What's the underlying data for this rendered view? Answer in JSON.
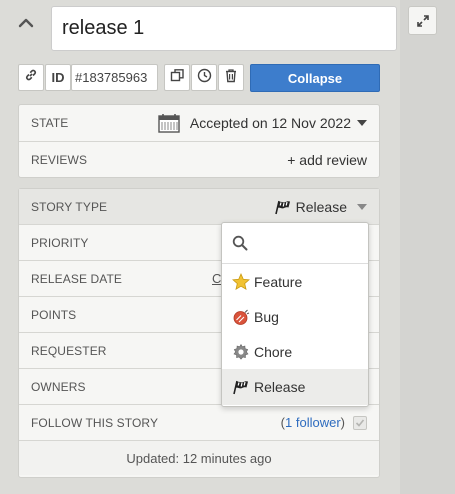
{
  "story": {
    "title": "release 1",
    "id_label": "ID",
    "id_value": "#183785963",
    "collapse_label": "Collapse"
  },
  "state": {
    "label": "STATE",
    "value": "Accepted on 12 Nov 2022"
  },
  "reviews": {
    "label": "REVIEWS",
    "add_label": "+ add review"
  },
  "fields": {
    "story_type": {
      "label": "STORY TYPE",
      "value": "Release"
    },
    "priority": {
      "label": "PRIORITY"
    },
    "release_date": {
      "label": "RELEASE DATE",
      "value_partial": "C"
    },
    "points": {
      "label": "POINTS"
    },
    "requester": {
      "label": "REQUESTER"
    },
    "owners": {
      "label": "OWNERS"
    },
    "follow": {
      "label": "FOLLOW THIS STORY",
      "open_paren": "(",
      "follower_link": "1 follower",
      "close_paren": ")"
    }
  },
  "updated": "Updated: 12 minutes ago",
  "story_type_menu": {
    "options": [
      {
        "label": "Feature",
        "icon": "star-icon"
      },
      {
        "label": "Bug",
        "icon": "bug-icon"
      },
      {
        "label": "Chore",
        "icon": "gear-icon"
      },
      {
        "label": "Release",
        "icon": "flag-icon",
        "selected": true
      }
    ]
  },
  "colors": {
    "accent": "#3d7dcc",
    "link": "#2e6cbf",
    "panel_bg": "#dcdcd8"
  }
}
